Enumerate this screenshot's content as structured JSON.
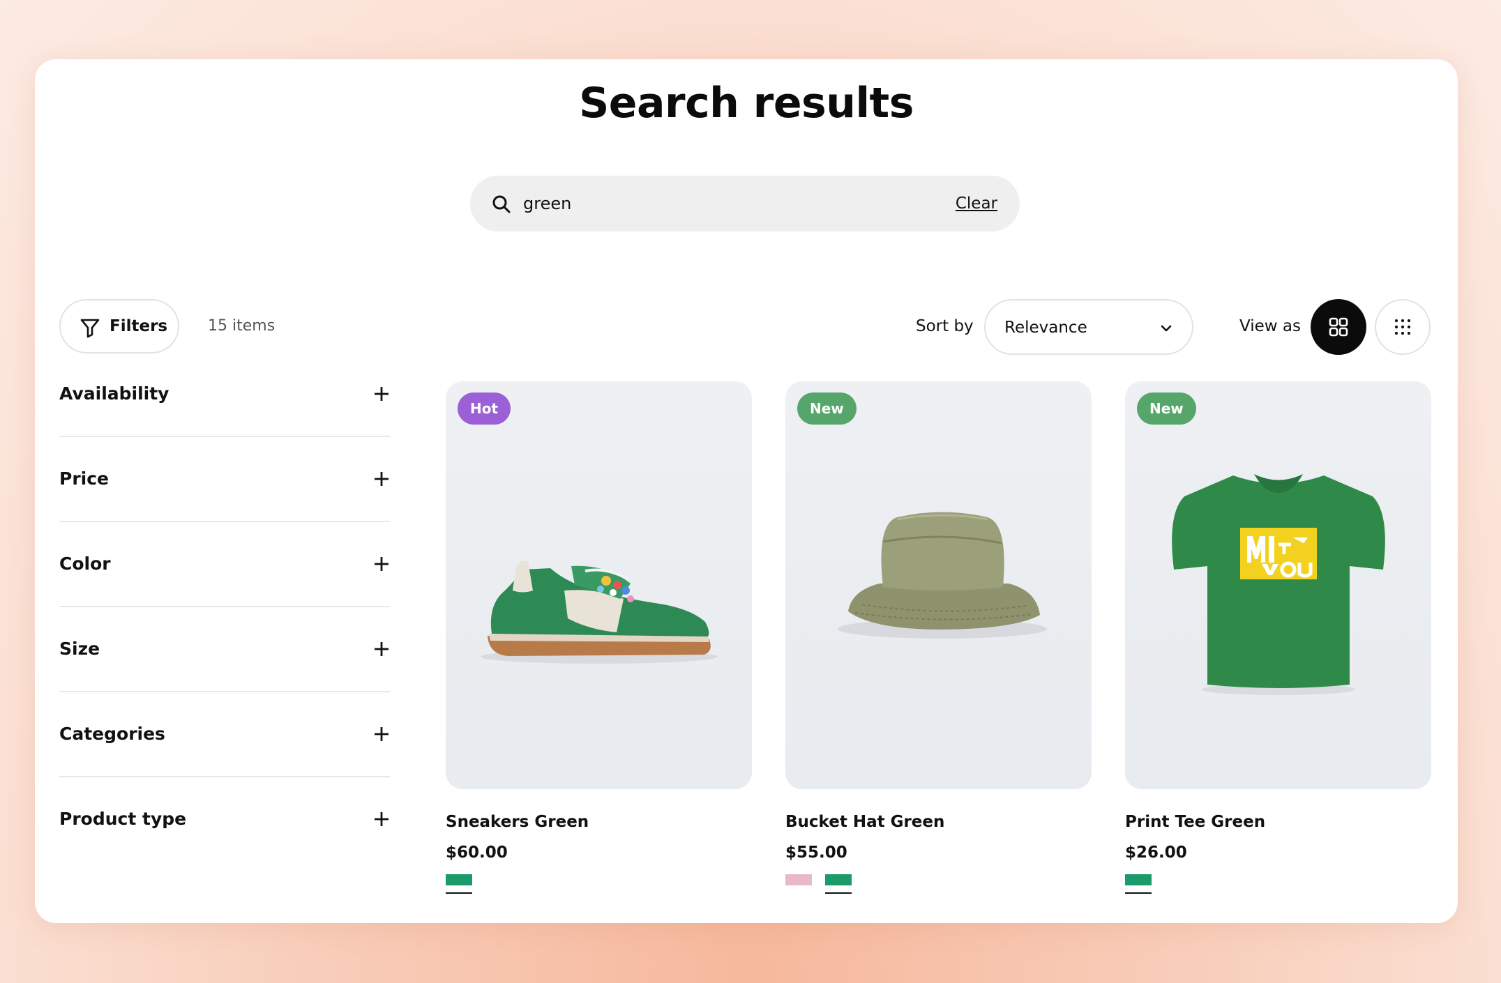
{
  "page": {
    "title": "Search results"
  },
  "search": {
    "value": "green",
    "clear_label": "Clear"
  },
  "toolbar": {
    "filters_label": "Filters",
    "items_count": "15 items",
    "sort_label": "Sort by",
    "sort_value": "Relevance",
    "view_label": "View as",
    "view_modes": [
      "grid-large-icon",
      "grid-small-icon"
    ],
    "active_view": "grid-large-icon"
  },
  "facets": [
    {
      "label": "Availability"
    },
    {
      "label": "Price"
    },
    {
      "label": "Color"
    },
    {
      "label": "Size"
    },
    {
      "label": "Categories"
    },
    {
      "label": "Product type"
    }
  ],
  "products": [
    {
      "title": "Sneakers Green",
      "price": "$60.00",
      "badge": "Hot",
      "badge_color": "#9b5fd6",
      "image": "green-sneaker",
      "swatches": [
        {
          "color": "#1b9a6b",
          "selected": true
        }
      ]
    },
    {
      "title": "Bucket Hat Green",
      "price": "$55.00",
      "badge": "New",
      "badge_color": "#56a66b",
      "image": "olive-bucket-hat",
      "swatches": [
        {
          "color": "#e8b8cc",
          "selected": false
        },
        {
          "color": "#1b9a6b",
          "selected": true
        }
      ]
    },
    {
      "title": "Print Tee Green",
      "price": "$26.00",
      "badge": "New",
      "badge_color": "#56a66b",
      "image": "green-print-tee",
      "swatches": [
        {
          "color": "#1b9a6b",
          "selected": true
        }
      ]
    }
  ],
  "colors": {
    "active_view_bg": "#0b0b0b",
    "border": "#e2e2e2",
    "search_bg": "#efefef"
  }
}
